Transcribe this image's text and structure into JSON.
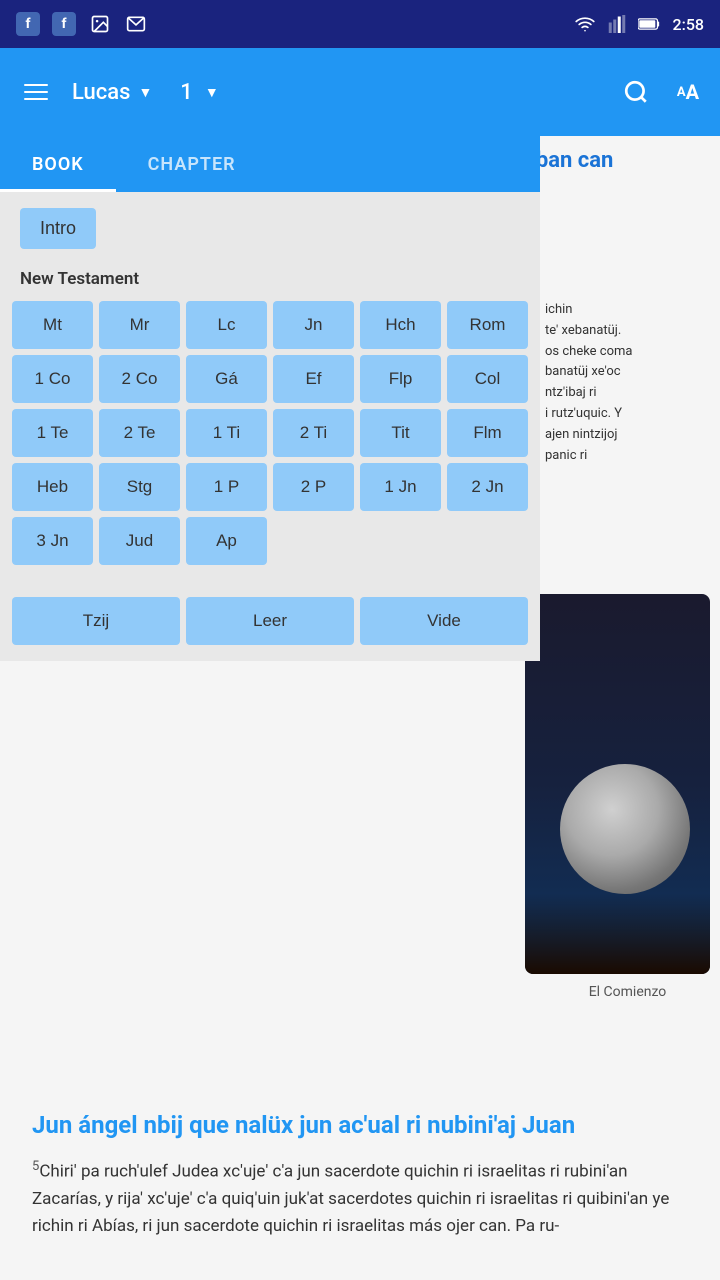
{
  "status_bar": {
    "time": "2:58",
    "icons_left": [
      "facebook",
      "facebook",
      "image",
      "mail"
    ],
    "icons_right": [
      "wifi",
      "signal",
      "battery"
    ]
  },
  "app_bar": {
    "menu_label": "Menu",
    "book_title": "Lucas",
    "chapter_number": "1",
    "search_label": "Search",
    "font_label": "Font size"
  },
  "tabs": [
    {
      "id": "book",
      "label": "BOOK",
      "active": true
    },
    {
      "id": "chapter",
      "label": "CHAPTER",
      "active": false
    }
  ],
  "intro_button": "Intro",
  "section_header": "New Testament",
  "book_grid": [
    "Mt",
    "Mr",
    "Lc",
    "Jn",
    "Hch",
    "Rom",
    "1 Co",
    "2 Co",
    "Gá",
    "Ef",
    "Flp",
    "Col",
    "1 Te",
    "2 Te",
    "1 Ti",
    "2 Ti",
    "Tit",
    "Flm",
    "Heb",
    "Stg",
    "1 P",
    "2 P",
    "1 Jn",
    "2 Jn",
    "3 Jn",
    "Jud",
    "Ap"
  ],
  "footer_buttons": [
    "Tzij",
    "Leer",
    "Vide"
  ],
  "background_text": {
    "partial_heading": "iban can",
    "bg_lines": [
      "ichin",
      "te' xebanatüj.",
      "os cheke coma",
      "banatüj xe'oc",
      "ntz'ibaj ri",
      "i rutz'uquic. Y",
      "ajen nintzijoj",
      "panic ri"
    ]
  },
  "image_caption": "El Comienzo",
  "bible_heading": "Jun ángel nbij que nalüx jun ac'ual ri nubini'aj Juan",
  "bible_paragraph": "Chiri' pa ruch'ulef Judea xc'uje' c'a jun sacerdote quichin ri israelitas ri rubini'an Zacarías, y rija' xc'uje' c'a quiq'uin juk'at sacerdotes quichin ri israelitas ri quibini'an ye richin ri Abías, ri jun sacerdote quichin ri israelitas más ojer can. Pa ru-",
  "verse_number": "5"
}
